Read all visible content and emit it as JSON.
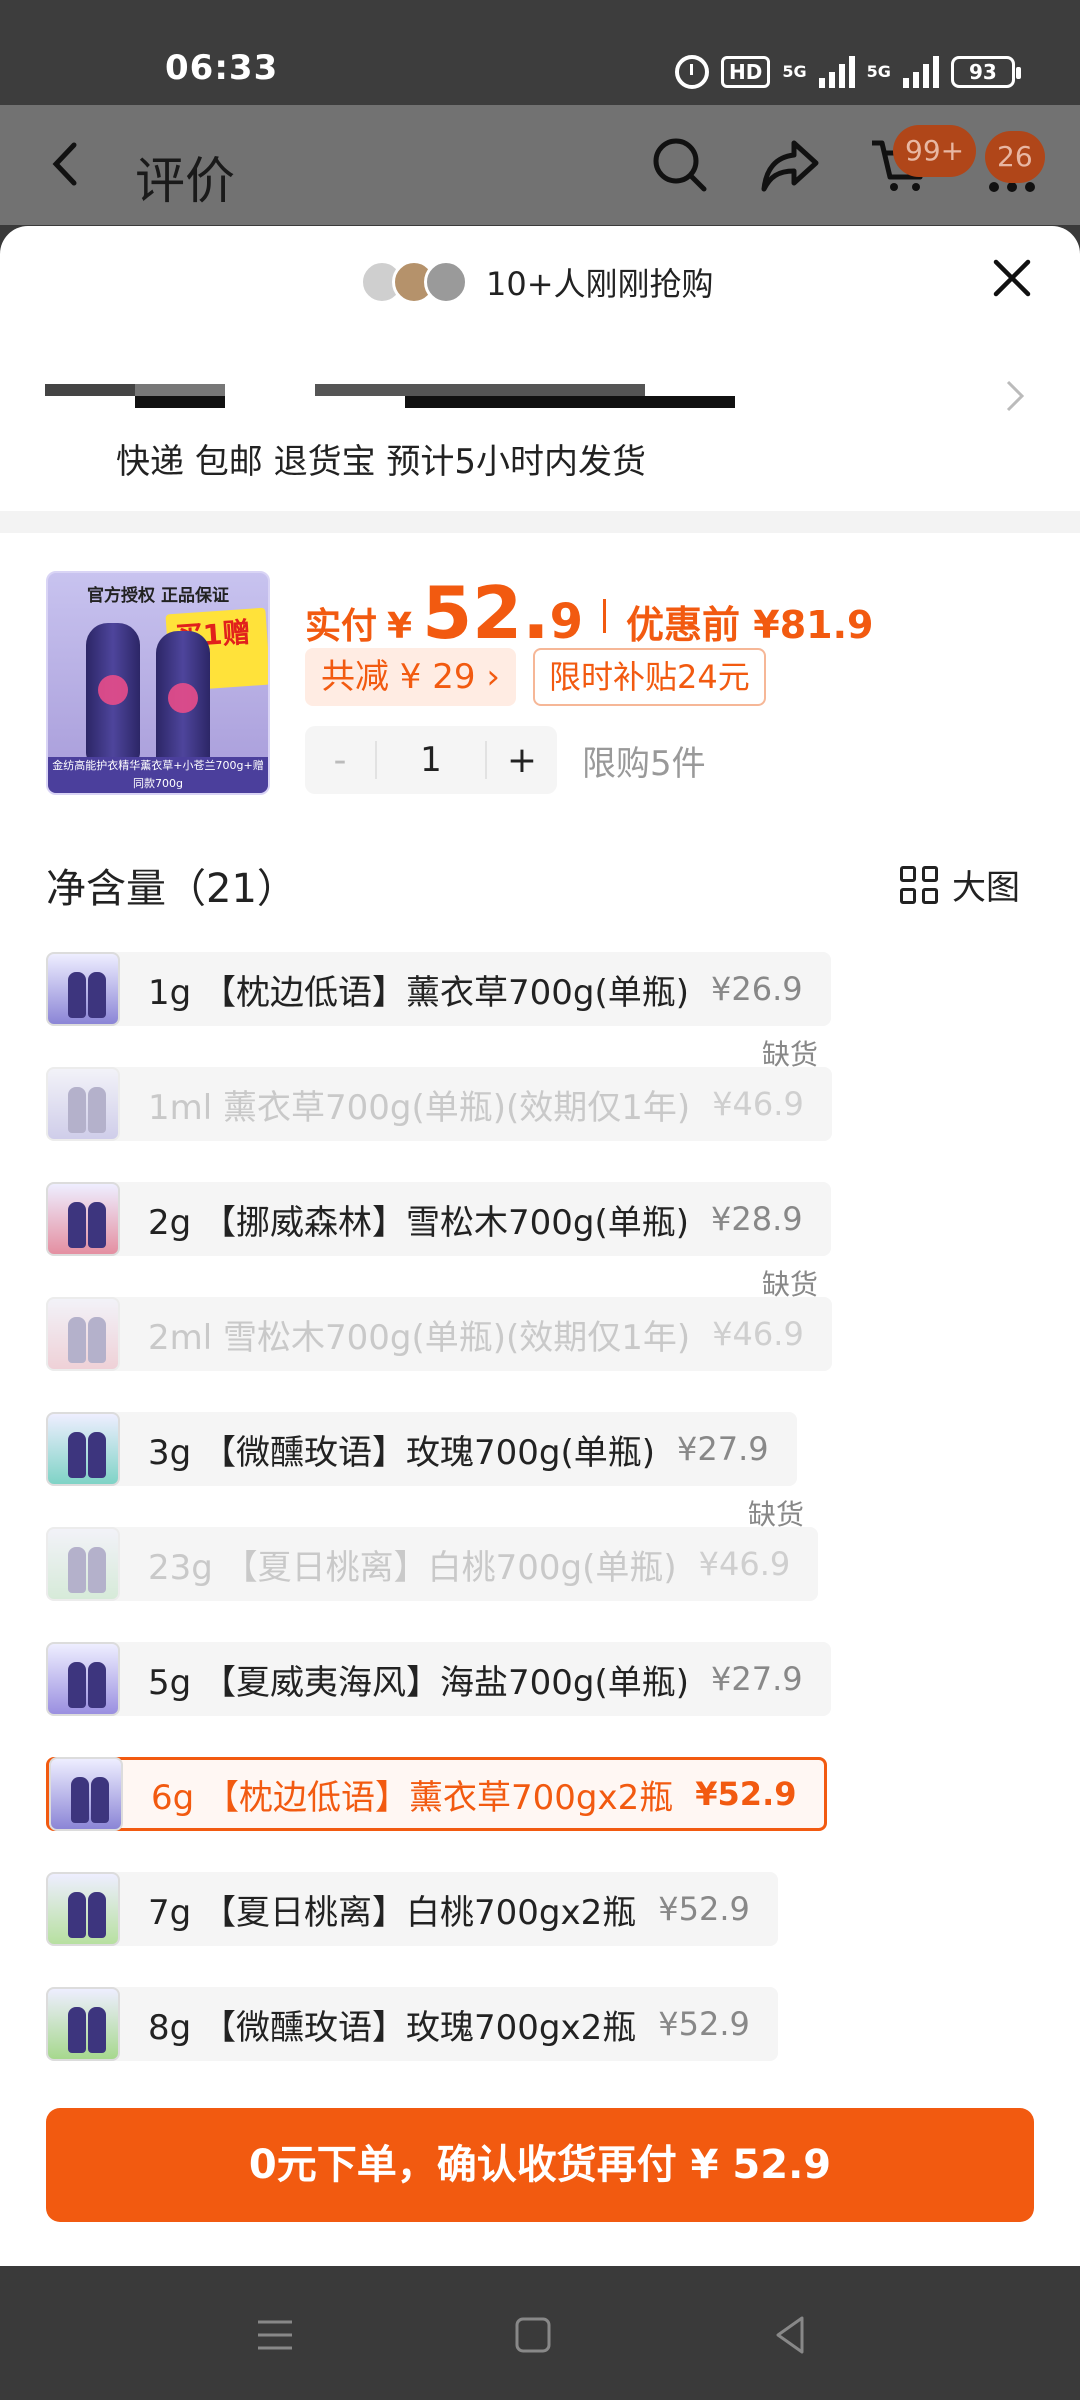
{
  "status": {
    "time": "06:33",
    "hd": "HD",
    "net1": "5G",
    "net2": "5G",
    "battery": "93"
  },
  "nav": {
    "title": "评价",
    "cart_badge": "99+",
    "msg_badge": "26"
  },
  "sheet": {
    "buyers_text": "10+人刚刚抢购",
    "shipping": "快递 包邮 退货宝 预计5小时内发货"
  },
  "product": {
    "img_tag": "官方授权 正品保证",
    "img_promo": "买1赠1",
    "img_footer": "金纺高能护衣精华薰衣草+小苍兰700g+赠同款700g",
    "pay_label": "实付",
    "currency": "¥",
    "price_int": "52.",
    "price_dec": "9",
    "orig_label": "优惠前 ¥81.9",
    "discount_chip": "共减 ¥ 29 ›",
    "subsidy_chip": "限时补贴24元",
    "qty_minus": "-",
    "qty": "1",
    "qty_plus": "+",
    "limit": "限购5件"
  },
  "options": {
    "header": "净含量（21）",
    "big_pic": "大图",
    "out_of_stock": "缺货",
    "items": [
      {
        "name": "1g 【枕边低语】薰衣草700g(单瓶)",
        "price": "¥26.9",
        "state": "normal",
        "color": "#8b85d6"
      },
      {
        "name": "1ml 薰衣草700g(单瓶)(效期仅1年)",
        "price": "¥46.9",
        "state": "oos",
        "color": "#8b85d6"
      },
      {
        "name": "2g 【挪威森林】雪松木700g(单瓶)",
        "price": "¥28.9",
        "state": "normal",
        "color": "#e48fa1"
      },
      {
        "name": "2ml 雪松木700g(单瓶)(效期仅1年)",
        "price": "¥46.9",
        "state": "oos",
        "color": "#e48fa1"
      },
      {
        "name": "3g 【微醺玫语】玫瑰700g(单瓶)",
        "price": "¥27.9",
        "state": "normal",
        "color": "#7fd3c6"
      },
      {
        "name": "23g 【夏日桃离】白桃700g(单瓶)",
        "price": "¥46.9",
        "state": "oos",
        "color": "#9fd8a6"
      },
      {
        "name": "5g 【夏威夷海风】海盐700g(单瓶)",
        "price": "¥27.9",
        "state": "normal",
        "color": "#9a8fe0"
      },
      {
        "name": "6g 【枕边低语】薰衣草700gx2瓶",
        "price": "¥52.9",
        "state": "selected",
        "color": "#8b85d6"
      },
      {
        "name": "7g 【夏日桃离】白桃700gx2瓶",
        "price": "¥52.9",
        "state": "normal",
        "color": "#b7e0a0"
      },
      {
        "name": "8g 【微醺玫语】玫瑰700gx2瓶",
        "price": "¥52.9",
        "state": "normal",
        "color": "#a6d88d"
      }
    ]
  },
  "cta": "0元下单，确认收货再付 ¥ 52.9"
}
